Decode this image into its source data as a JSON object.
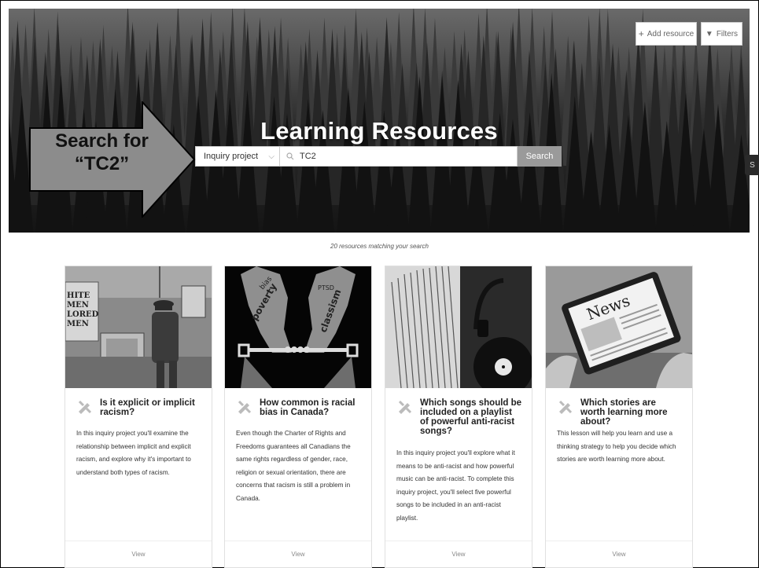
{
  "header": {
    "title": "Learning Resources",
    "add_resource_label": "Add resource",
    "filters_label": "Filters"
  },
  "search": {
    "select_value": "Inquiry project",
    "query": "TC2",
    "button_label": "Search"
  },
  "callout": {
    "line1": "Search for",
    "line2": "“TC2”"
  },
  "side_tab_label": "S",
  "results": {
    "count_text": "20 resources matching your search"
  },
  "cards": [
    {
      "title": "Is it explicit or implicit racism?",
      "description": "In this inquiry project you'll examine the relationship between implicit and explicit racism, and explore why it's important to understand both types of racism.",
      "view_label": "View",
      "image_text": "HITE MEN LORED MEN"
    },
    {
      "title": "How common is racial bias in Canada?",
      "description": "Even though the Charter of Rights and Freedoms guarantees all Canadians the same rights regardless of gender, race, religion or sexual orientation, there are concerns that racism is still a problem in Canada.",
      "view_label": "View",
      "image_text": "bias PTSD poverty classism"
    },
    {
      "title": "Which songs should be included on a playlist of powerful anti-racist songs?",
      "description": "In this inquiry project you'll explore what it means to be anti-racist and how powerful music can be anti-racist. To complete this inquiry project, you'll select five powerful songs to be included in an anti-racist playlist.",
      "view_label": "View",
      "image_text": ""
    },
    {
      "title": "Which stories are worth learning more about?",
      "description": "This lesson will help you learn and use a thinking strategy to help you decide which stories are worth learning more about.",
      "view_label": "View",
      "image_text": "News"
    }
  ]
}
